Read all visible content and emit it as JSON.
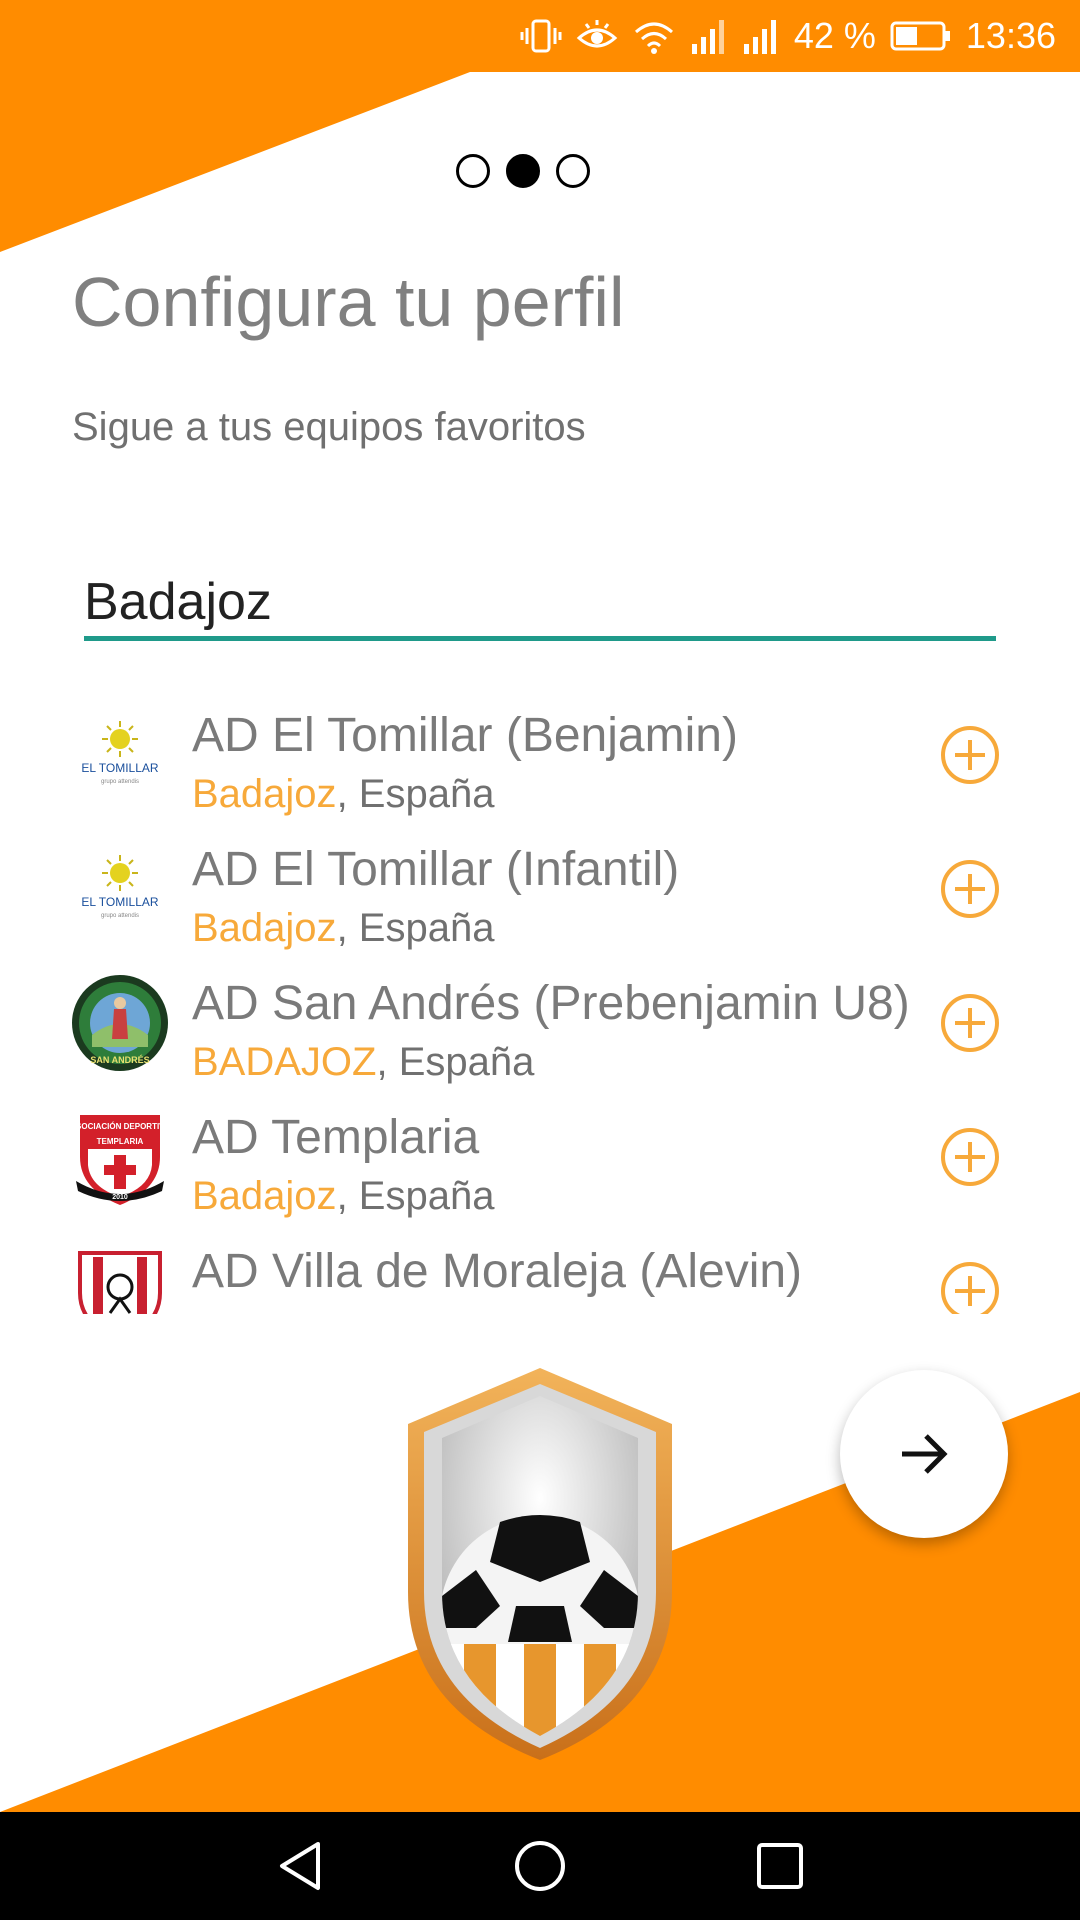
{
  "colors": {
    "accent": "#ff8c00",
    "accent_light": "#f7a93a",
    "underline": "#1f9a8a",
    "text_gray": "#7a7a7a"
  },
  "status_bar": {
    "battery": "42 %",
    "time": "13:36",
    "icons": [
      "vibrate-icon",
      "eye-icon",
      "wifi-icon",
      "signal-icon",
      "signal-icon",
      "battery-icon"
    ]
  },
  "pager": {
    "pages": 3,
    "active_index": 1
  },
  "header": {
    "title": "Configura tu perfil",
    "subtitle": "Sigue a tus equipos favoritos"
  },
  "search": {
    "value": "Badajoz"
  },
  "teams": [
    {
      "name": "AD El Tomillar (Benjamin)",
      "city": "Badajoz",
      "country": ", España",
      "logo": "el-tomillar-logo"
    },
    {
      "name": "AD El Tomillar (Infantil)",
      "city": "Badajoz",
      "country": ", España",
      "logo": "el-tomillar-logo"
    },
    {
      "name": "AD San Andrés (Prebenjamin U8)",
      "city": "BADAJOZ",
      "country": ", España",
      "logo": "san-andres-logo"
    },
    {
      "name": "AD Templaria",
      "city": "Badajoz",
      "country": ", España",
      "logo": "templaria-logo"
    },
    {
      "name": "AD Villa de Moraleja (Alevin)",
      "city": "",
      "country": "",
      "logo": "villa-moraleja-logo"
    }
  ],
  "logos": {
    "tomillar_text": "EL TOMILLAR",
    "tomillar_sub": "grupo attendis",
    "templaria_top": "ASOCIACIÓN DEPORTIVA",
    "templaria_name": "TEMPLARIA",
    "templaria_year": "2010",
    "san_andres_text": "SAN ANDRÉS"
  },
  "next_button": {
    "icon": "arrow-right-icon"
  },
  "nav_bar": {
    "icons": [
      "back-icon",
      "home-icon",
      "recents-icon"
    ]
  }
}
